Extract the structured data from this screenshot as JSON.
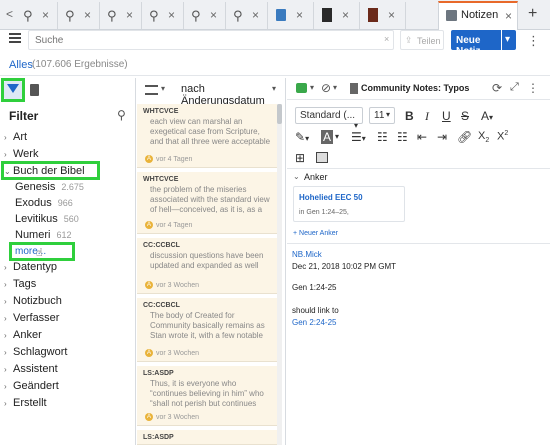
{
  "tabs": [
    {
      "icon": "search-icon",
      "close": "×"
    },
    {
      "icon": "search-icon",
      "close": "×"
    },
    {
      "icon": "search-icon",
      "close": "×"
    },
    {
      "icon": "search-icon",
      "close": "×"
    },
    {
      "icon": "search-icon",
      "close": "×"
    },
    {
      "icon": "search-icon",
      "close": "×"
    },
    {
      "icon": "library-icon",
      "close": "×"
    },
    {
      "icon": "book-icon",
      "close": "×"
    },
    {
      "icon": "book-icon",
      "close": "×"
    },
    {
      "icon": "notes-icon",
      "label": "Notizen",
      "close": "×"
    }
  ],
  "tabbar": {
    "back": "<",
    "add": "+"
  },
  "toolbar": {
    "search_placeholder": "Suche",
    "share_label": "Teilen",
    "new_note_label": "Neue Notiz",
    "dropdown": "▾",
    "more": "⋮"
  },
  "results": {
    "all_label": "Alles",
    "count": "(107.606 Ergebnisse)"
  },
  "filter": {
    "title": "Filter",
    "items": [
      {
        "label": "Art",
        "chev": "›"
      },
      {
        "label": "Werk",
        "chev": "›"
      },
      {
        "label": "Buch der Bibel",
        "chev": "⌄"
      }
    ],
    "books": [
      {
        "label": "Genesis",
        "count": "2.675"
      },
      {
        "label": "Exodus",
        "count": "966"
      },
      {
        "label": "Levitikus",
        "count": "560"
      },
      {
        "label": "Numeri",
        "count": "612"
      }
    ],
    "more_label": "more...",
    "items2": [
      {
        "label": "Datentyp",
        "chev": "›"
      },
      {
        "label": "Tags",
        "chev": "›"
      },
      {
        "label": "Notizbuch",
        "chev": "›"
      },
      {
        "label": "Verfasser",
        "chev": "›"
      },
      {
        "label": "Anker",
        "chev": "›"
      },
      {
        "label": "Schlagwort",
        "chev": "›"
      },
      {
        "label": "Assistent",
        "chev": "›"
      },
      {
        "label": "Geändert",
        "chev": "›"
      },
      {
        "label": "Erstellt",
        "chev": "›"
      }
    ]
  },
  "list": {
    "sort_label": "nach Änderungsdatum",
    "cards": [
      {
        "source": "WHTCVCE",
        "text": "each view can marshal an exegetical case from Scripture, and that all three were acceptable theological options",
        "avatar": "A",
        "time": "vor 4 Tagen"
      },
      {
        "source": "WHTCVCE",
        "text": "the problem of the miseries associated with the standard view of hell—conceived, as it is, as a place of",
        "avatar": "A",
        "time": "vor 4 Tagen"
      },
      {
        "source": "CC:CCBCL",
        "text": "discussion questions have been updated and expanded as well",
        "avatar": "A",
        "time": "vor 3 Wochen"
      },
      {
        "source": "CC:CCBCL",
        "text": "The body of Created for Community basically remains as Stan wrote it, with a few notable changes",
        "avatar": "A",
        "time": "vor 3 Wochen"
      },
      {
        "source": "LS:ASDP",
        "text": "Thus, it is everyone who “continues believing in him” who “shall not perish but continues having eternal",
        "avatar": "A",
        "time": "vor 3 Wochen"
      },
      {
        "source": "LS:ASDP",
        "text": "",
        "avatar": "",
        "time": ""
      }
    ]
  },
  "editor": {
    "notebook_label": "Community Notes: Typos",
    "style_select": "Standard (...",
    "size_select": "11",
    "anchor_section": "Anker",
    "anchor_title": "Hohelied EEC 50",
    "anchor_ref": "in Gen 1:24–25,",
    "new_anchor": "+ Neuer Anker",
    "author": "NB.Mick",
    "date": "Dec 21, 2018 10:02 PM GMT",
    "body1": "Gen 1:24-25",
    "body2": "should link to",
    "body_link": "Gen 2:24-25"
  },
  "colors": {
    "accent": "#1e66c8",
    "highlight_box": "#2fcf3c",
    "tab_active": "#e8692a",
    "card_bg": "#fcf5e6"
  }
}
